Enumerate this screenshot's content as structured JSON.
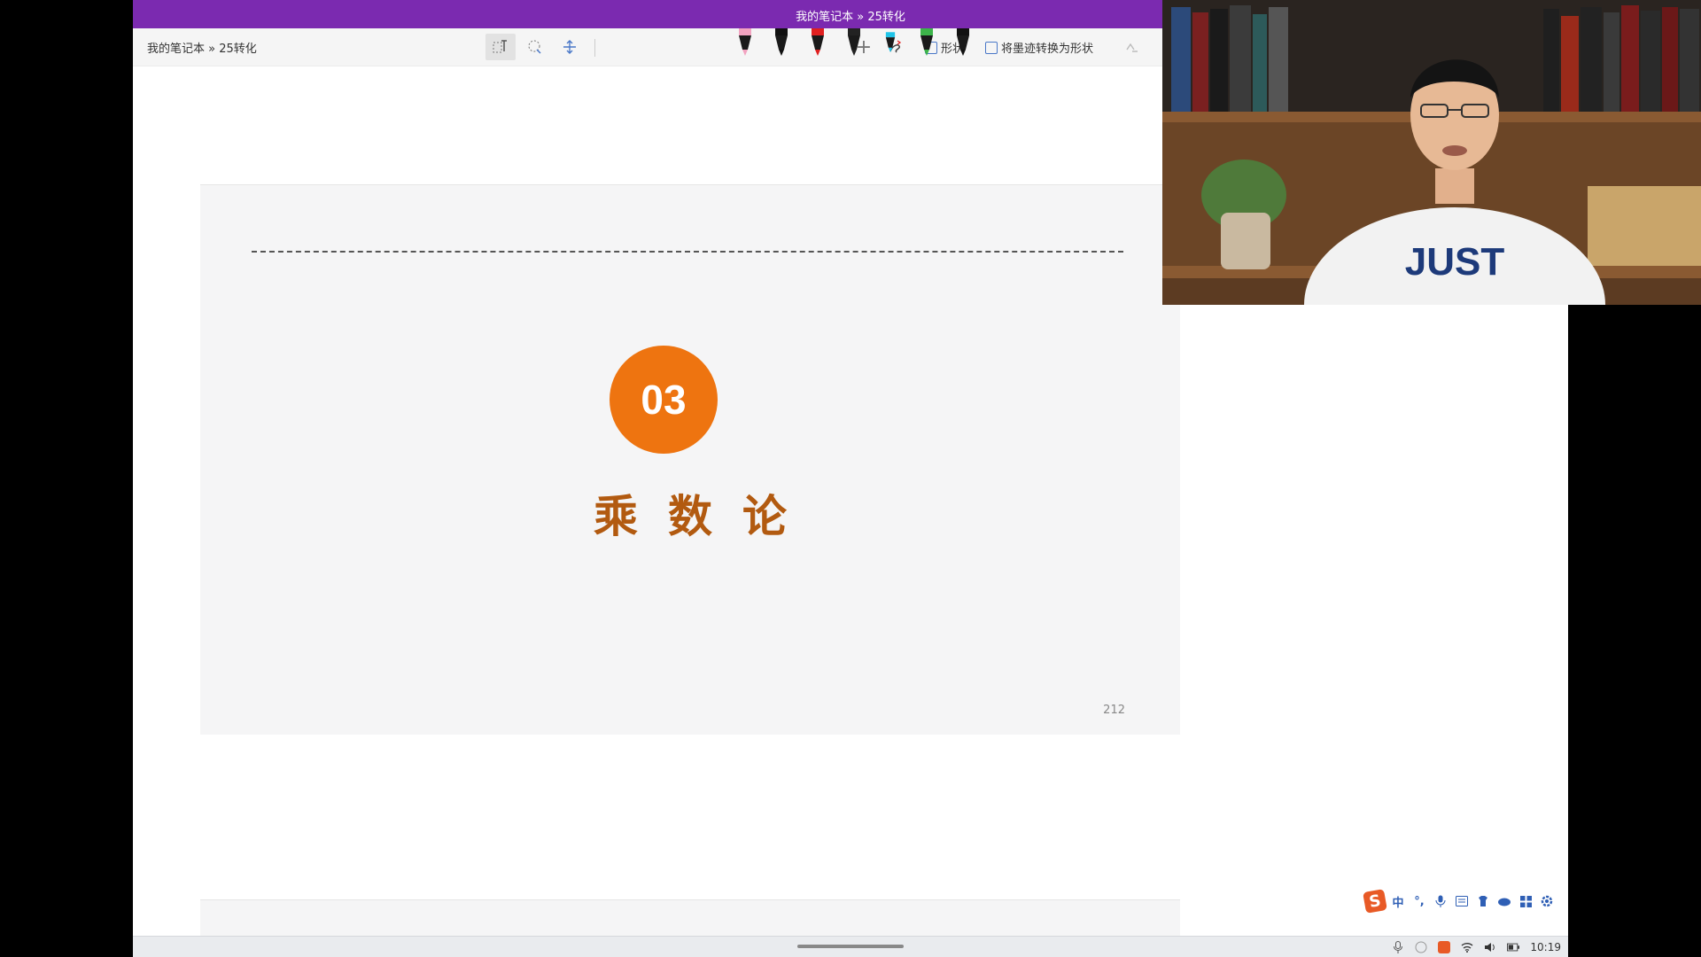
{
  "window": {
    "title": "我的笔记本 » 25转化"
  },
  "toolbar": {
    "breadcrumb": "我的笔记本 » 25转化",
    "shape_label": "形状",
    "ink_to_shape_label": "将墨迹转换为形状",
    "pens": [
      {
        "name": "pen-pink",
        "color": "#f2a3c0"
      },
      {
        "name": "pen-black-1",
        "color": "#111111"
      },
      {
        "name": "pen-red",
        "color": "#e02020"
      },
      {
        "name": "pen-black-2",
        "color": "#222222"
      },
      {
        "name": "pen-cyan",
        "color": "#20c4e8"
      },
      {
        "name": "pen-green",
        "color": "#3cb44a"
      },
      {
        "name": "pen-black-3",
        "color": "#111111"
      }
    ]
  },
  "slide": {
    "number_badge": "03",
    "title": "乘数论",
    "page_number": "212",
    "accent_color": "#ee7410",
    "title_color": "#b25a10"
  },
  "ime": {
    "mode_label": "中",
    "logo": "S"
  },
  "tray": {
    "time": "10:19"
  }
}
